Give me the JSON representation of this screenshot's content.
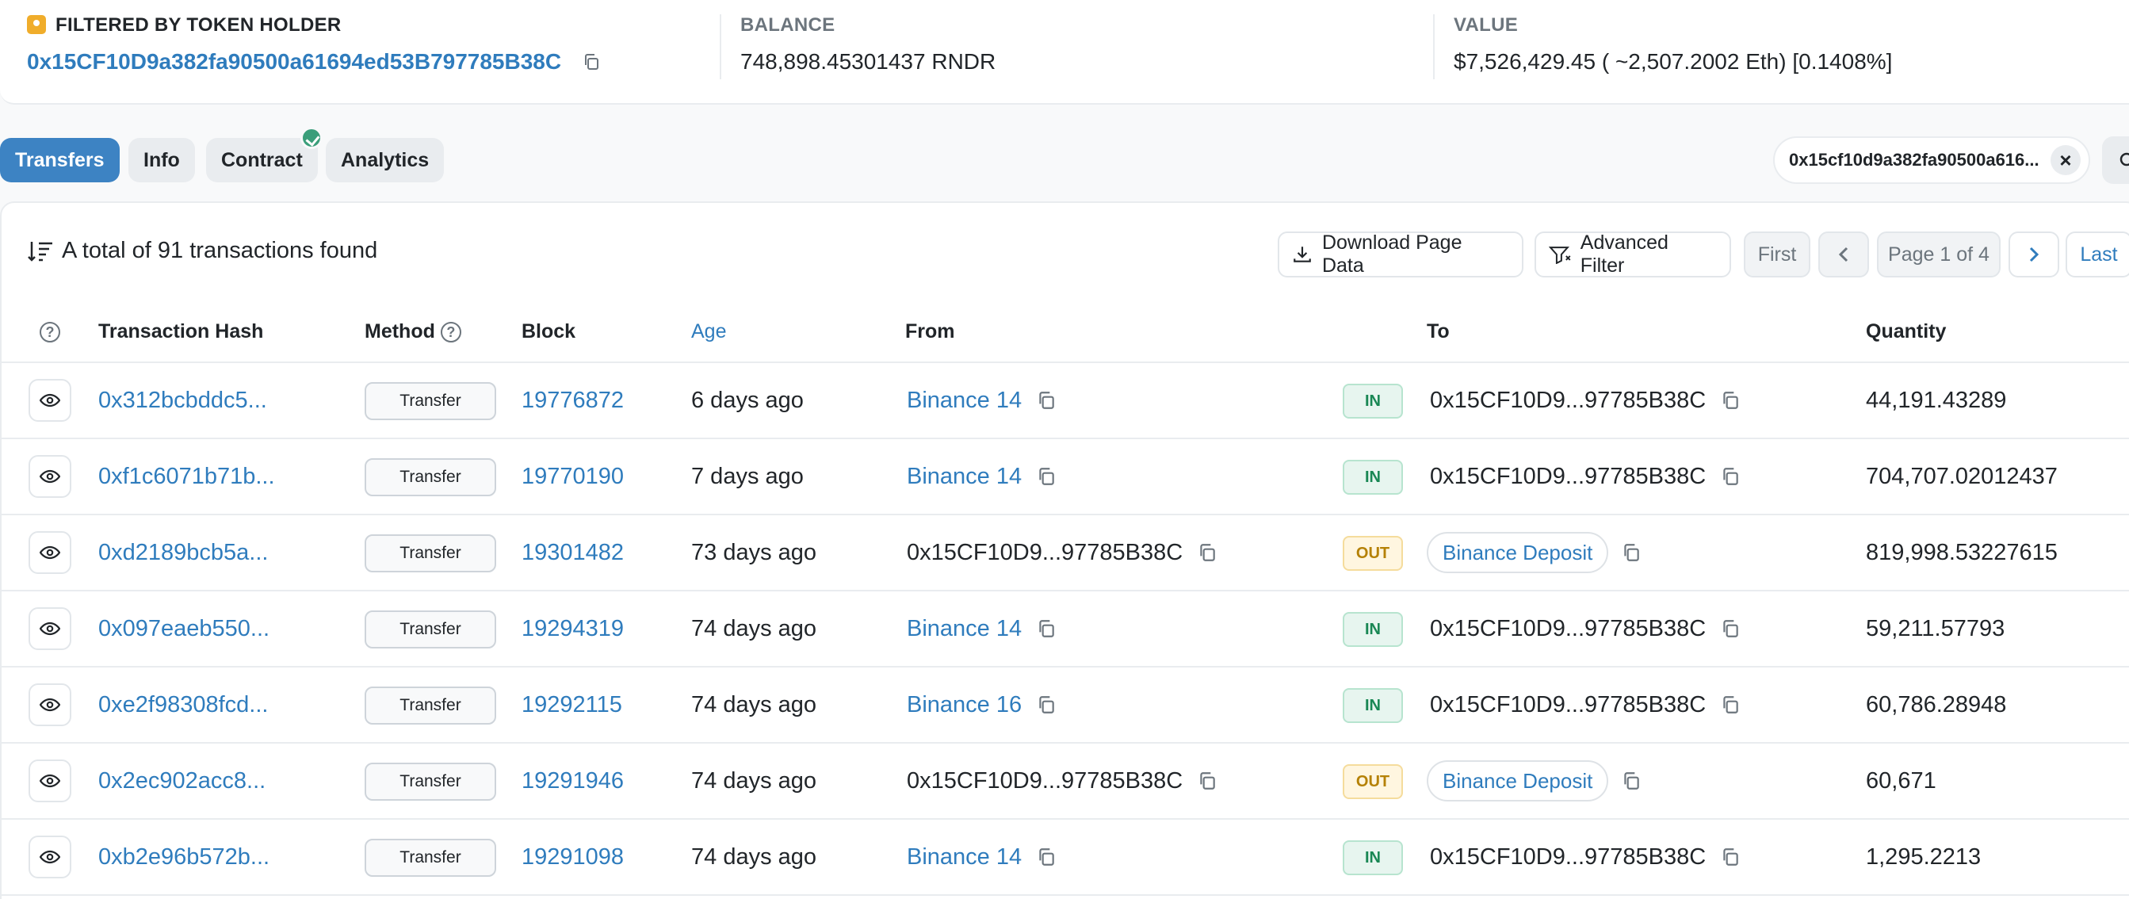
{
  "info": {
    "holder_label": "FILTERED BY TOKEN HOLDER",
    "holder_address": "0x15CF10D9a382fa90500a61694ed53B797785B38C",
    "balance_label": "BALANCE",
    "balance_value": "748,898.45301437 RNDR",
    "value_label": "VALUE",
    "value_value": "$7,526,429.45 ( ~2,507.2002 Eth) [0.1408%]"
  },
  "tabs": [
    {
      "label": "Transfers",
      "active": true
    },
    {
      "label": "Info"
    },
    {
      "label": "Contract",
      "verified": true
    },
    {
      "label": "Analytics"
    }
  ],
  "filter_chip": {
    "text": "0x15cf10d9a382fa90500a616..."
  },
  "summary": "A total of 91 transactions found",
  "toolbar": {
    "download_label": "Download Page Data",
    "advanced_filter_label": "Advanced Filter",
    "first_label": "First",
    "page_label": "Page 1 of 4",
    "last_label": "Last"
  },
  "columns": {
    "hash": "Transaction Hash",
    "method": "Method",
    "block": "Block",
    "age": "Age",
    "from": "From",
    "to": "To",
    "quantity": "Quantity"
  },
  "rows": [
    {
      "hash": "0x312bcbddc5...",
      "method": "Transfer",
      "block": "19776872",
      "age": "6 days ago",
      "from": "Binance 14",
      "from_link": true,
      "dir": "IN",
      "to": "0x15CF10D9...97785B38C",
      "to_pill": false,
      "quantity": "44,191.43289"
    },
    {
      "hash": "0xf1c6071b71b...",
      "method": "Transfer",
      "block": "19770190",
      "age": "7 days ago",
      "from": "Binance 14",
      "from_link": true,
      "dir": "IN",
      "to": "0x15CF10D9...97785B38C",
      "to_pill": false,
      "quantity": "704,707.02012437"
    },
    {
      "hash": "0xd2189bcb5a...",
      "method": "Transfer",
      "block": "19301482",
      "age": "73 days ago",
      "from": "0x15CF10D9...97785B38C",
      "from_link": false,
      "dir": "OUT",
      "to": "Binance Deposit",
      "to_pill": true,
      "quantity": "819,998.53227615"
    },
    {
      "hash": "0x097eaeb550...",
      "method": "Transfer",
      "block": "19294319",
      "age": "74 days ago",
      "from": "Binance 14",
      "from_link": true,
      "dir": "IN",
      "to": "0x15CF10D9...97785B38C",
      "to_pill": false,
      "quantity": "59,211.57793"
    },
    {
      "hash": "0xe2f98308fcd...",
      "method": "Transfer",
      "block": "19292115",
      "age": "74 days ago",
      "from": "Binance 16",
      "from_link": true,
      "dir": "IN",
      "to": "0x15CF10D9...97785B38C",
      "to_pill": false,
      "quantity": "60,786.28948"
    },
    {
      "hash": "0x2ec902acc8...",
      "method": "Transfer",
      "block": "19291946",
      "age": "74 days ago",
      "from": "0x15CF10D9...97785B38C",
      "from_link": false,
      "dir": "OUT",
      "to": "Binance Deposit",
      "to_pill": true,
      "quantity": "60,671"
    },
    {
      "hash": "0xb2e96b572b...",
      "method": "Transfer",
      "block": "19291098",
      "age": "74 days ago",
      "from": "Binance 14",
      "from_link": true,
      "dir": "IN",
      "to": "0x15CF10D9...97785B38C",
      "to_pill": false,
      "quantity": "1,295.2213"
    }
  ]
}
